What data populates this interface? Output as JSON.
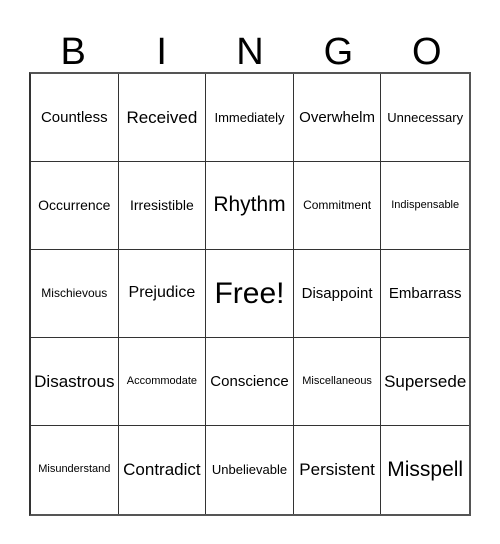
{
  "card": {
    "title": "BINGO",
    "header_letters": [
      "B",
      "I",
      "N",
      "G",
      "O"
    ],
    "grid_size": "5x5",
    "free_space": "Free!",
    "colors": {
      "background": "#ffffff",
      "text": "#000000",
      "grid_line": "#333333",
      "grid_outer": "#555555"
    },
    "rows": [
      [
        {
          "text": "Countless",
          "size": "ml"
        },
        {
          "text": "Received",
          "size": "xl"
        },
        {
          "text": "Immediately",
          "size": "sm"
        },
        {
          "text": "Overwhelm",
          "size": "ml"
        },
        {
          "text": "Unnecessary",
          "size": "sm"
        }
      ],
      [
        {
          "text": "Occurrence",
          "size": "m"
        },
        {
          "text": "Irresistible",
          "size": "m"
        },
        {
          "text": "Rhythm",
          "size": "xxl"
        },
        {
          "text": "Commitment",
          "size": "s"
        },
        {
          "text": "Indispensable",
          "size": "xs"
        }
      ],
      [
        {
          "text": "Mischievous",
          "size": "s"
        },
        {
          "text": "Prejudice",
          "size": "l"
        },
        {
          "text": "Free!",
          "size": "free"
        },
        {
          "text": "Disappoint",
          "size": "ml"
        },
        {
          "text": "Embarrass",
          "size": "ml"
        }
      ],
      [
        {
          "text": "Disastrous",
          "size": "xl"
        },
        {
          "text": "Accommodate",
          "size": "xs"
        },
        {
          "text": "Conscience",
          "size": "ml"
        },
        {
          "text": "Miscellaneous",
          "size": "xs"
        },
        {
          "text": "Supersede",
          "size": "xl"
        }
      ],
      [
        {
          "text": "Misunderstand",
          "size": "xs"
        },
        {
          "text": "Contradict",
          "size": "xl"
        },
        {
          "text": "Unbelievable",
          "size": "sm"
        },
        {
          "text": "Persistent",
          "size": "xl"
        },
        {
          "text": "Misspell",
          "size": "xxl"
        }
      ]
    ]
  }
}
